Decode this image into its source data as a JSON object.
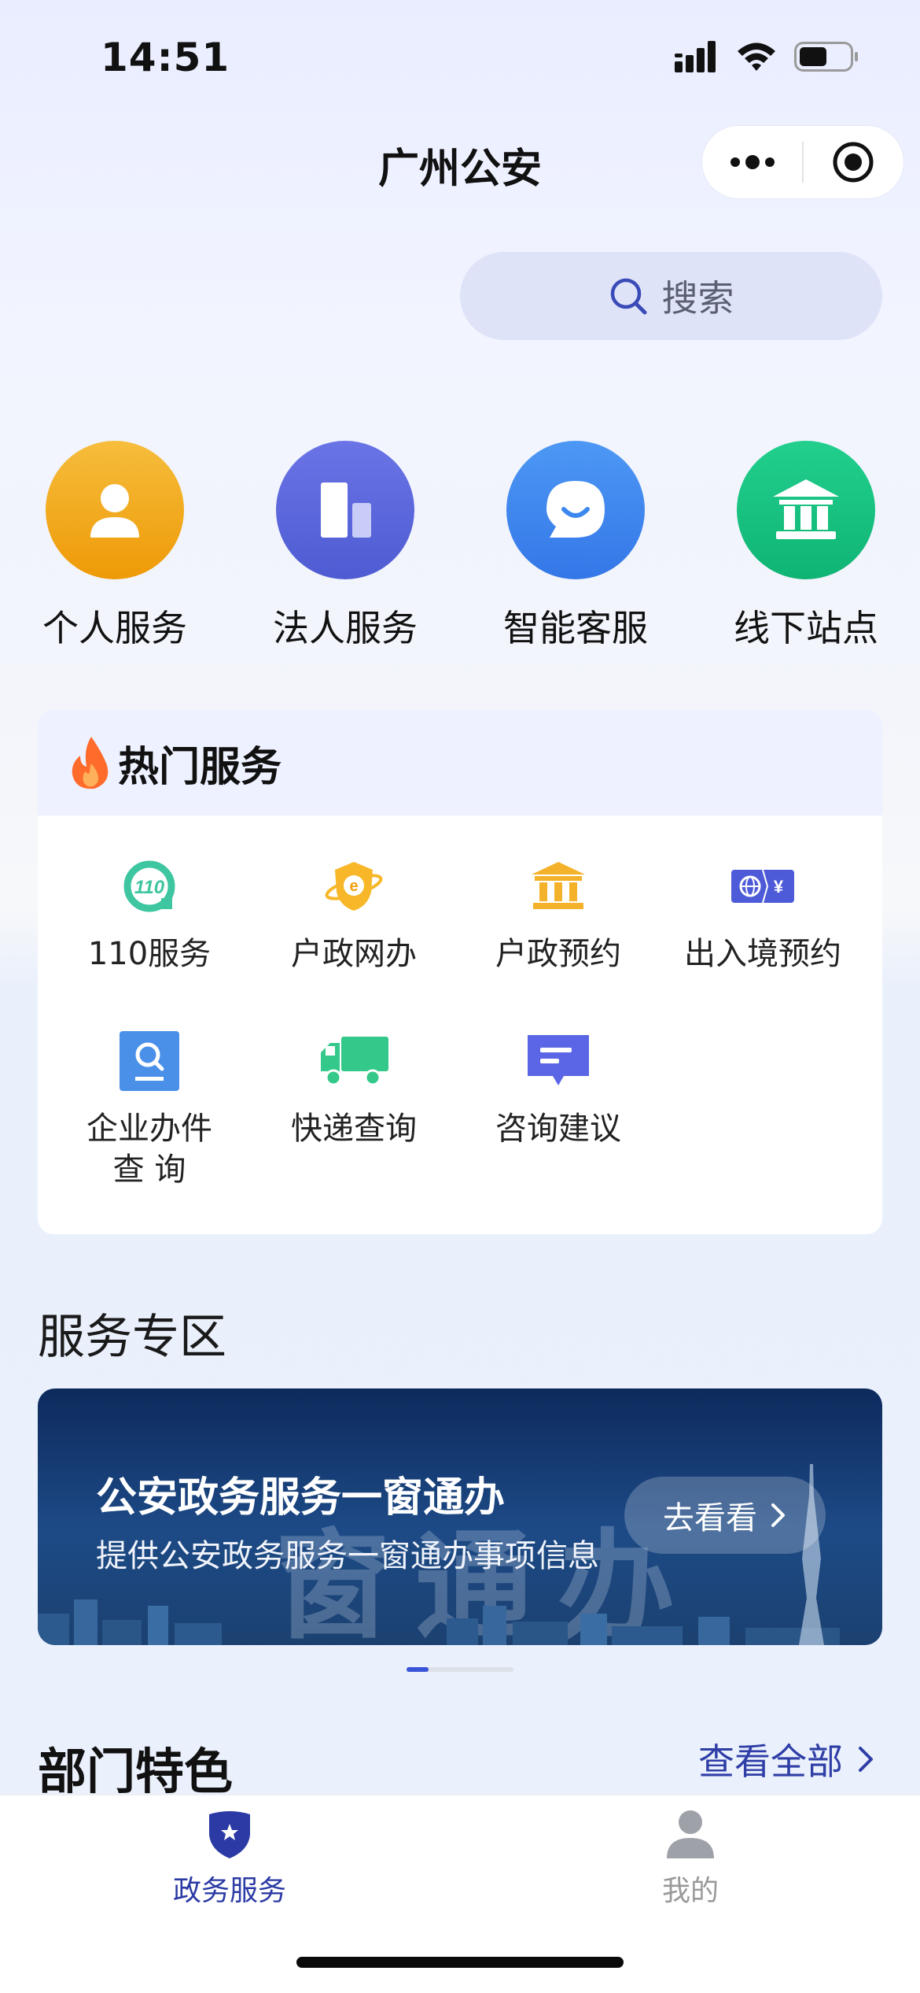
{
  "status_bar": {
    "time": "14:51"
  },
  "header": {
    "title": "广州公安"
  },
  "search": {
    "label": "搜索"
  },
  "main_nav": [
    {
      "label": "个人服务",
      "icon": "person-icon",
      "color": "#f2a516"
    },
    {
      "label": "法人服务",
      "icon": "building-icon",
      "color": "#5b68dc"
    },
    {
      "label": "智能客服",
      "icon": "chat-icon",
      "color": "#3d88ef"
    },
    {
      "label": "线下站点",
      "icon": "bank-icon",
      "color": "#17c07f"
    }
  ],
  "hot_services": {
    "title": "热门服务",
    "items": [
      {
        "label": "110服务",
        "icon": "110-icon"
      },
      {
        "label": "户政网办",
        "icon": "e-shield-icon"
      },
      {
        "label": "户政预约",
        "icon": "institution-icon"
      },
      {
        "label": "出入境预约",
        "icon": "exit-entry-icon"
      },
      {
        "label": "企业办件\n查 询",
        "icon": "search-doc-icon"
      },
      {
        "label": "快递查询",
        "icon": "truck-icon"
      },
      {
        "label": "咨询建议",
        "icon": "message-icon"
      }
    ]
  },
  "service_zone": {
    "title": "服务专区",
    "banner": {
      "background_text": "窗通办",
      "title": "公安政务服务一窗通办",
      "subtitle": "提供公安政务服务一窗通办事项信息",
      "button": "去看看"
    }
  },
  "department": {
    "title": "部门特色",
    "view_all": "查看全部"
  },
  "tabbar": {
    "items": [
      {
        "label": "政务服务",
        "active": true
      },
      {
        "label": "我的",
        "active": false
      }
    ]
  },
  "colors": {
    "accent": "#2f3ea6",
    "tab_active": "#2b3aa4",
    "tab_inactive": "#999999"
  }
}
